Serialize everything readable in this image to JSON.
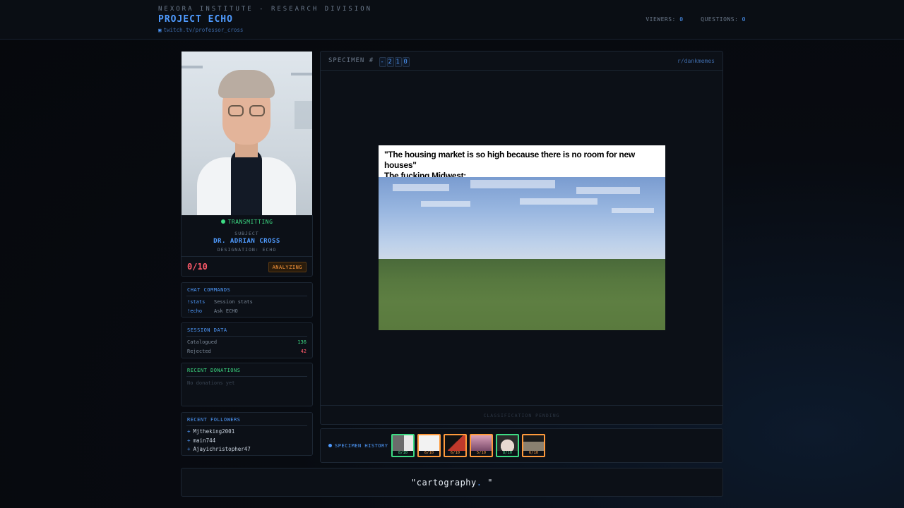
{
  "header": {
    "org": "NEXORA INSTITUTE - RESEARCH DIVISION",
    "project": "PROJECT ECHO",
    "channel": "twitch.tv/professor_cross",
    "viewers_label": "VIEWERS:",
    "viewers_value": "0",
    "questions_label": "QUESTIONS:",
    "questions_value": "0"
  },
  "subject": {
    "status": "TRANSMITTING",
    "label": "SUBJECT",
    "name": "DR. ADRIAN CROSS",
    "designation": "DESIGNATION: ECHO",
    "score": "0/10",
    "state": "ANALYZING"
  },
  "commands": {
    "title": "CHAT COMMANDS",
    "items": [
      {
        "cmd": "!stats",
        "desc": "Session stats"
      },
      {
        "cmd": "!echo",
        "desc": "Ask ECHO"
      }
    ]
  },
  "session": {
    "title": "SESSION DATA",
    "catalogued_label": "Catalogued",
    "catalogued_value": "136",
    "rejected_label": "Rejected",
    "rejected_value": "42"
  },
  "donations": {
    "title": "RECENT DONATIONS",
    "empty": "No donations yet"
  },
  "followers": {
    "title": "RECENT FOLLOWERS",
    "items": [
      "Mjtheking2001",
      "main744",
      "Ajayichristopher47"
    ]
  },
  "specimen": {
    "label": "SPECIMEN #",
    "digits": [
      "-",
      "2",
      "1",
      "0"
    ],
    "source": "r/dankmemes",
    "caption_line1": "\"The housing market is so high because there is no room for new houses\"",
    "caption_line2": "The fucking Midwest:",
    "footer": "CLASSIFICATION PENDING"
  },
  "history": {
    "label": "SPECIMEN HISTORY",
    "items": [
      {
        "score": "8/10",
        "color": "#3ddc84"
      },
      {
        "score": "6/10",
        "color": "#ff9a3c"
      },
      {
        "score": "6/10",
        "color": "#ff9a3c"
      },
      {
        "score": "5/10",
        "color": "#ff9a3c"
      },
      {
        "score": "8/10",
        "color": "#3ddc84"
      },
      {
        "score": "6/10",
        "color": "#ff9a3c"
      }
    ]
  },
  "quote": {
    "text": "\"cartography",
    "cursor": ".",
    "end": " \""
  },
  "colors": {
    "accent": "#4f9bff",
    "success": "#3ddc84",
    "warning": "#ff9a3c",
    "danger": "#ff5a6a"
  }
}
